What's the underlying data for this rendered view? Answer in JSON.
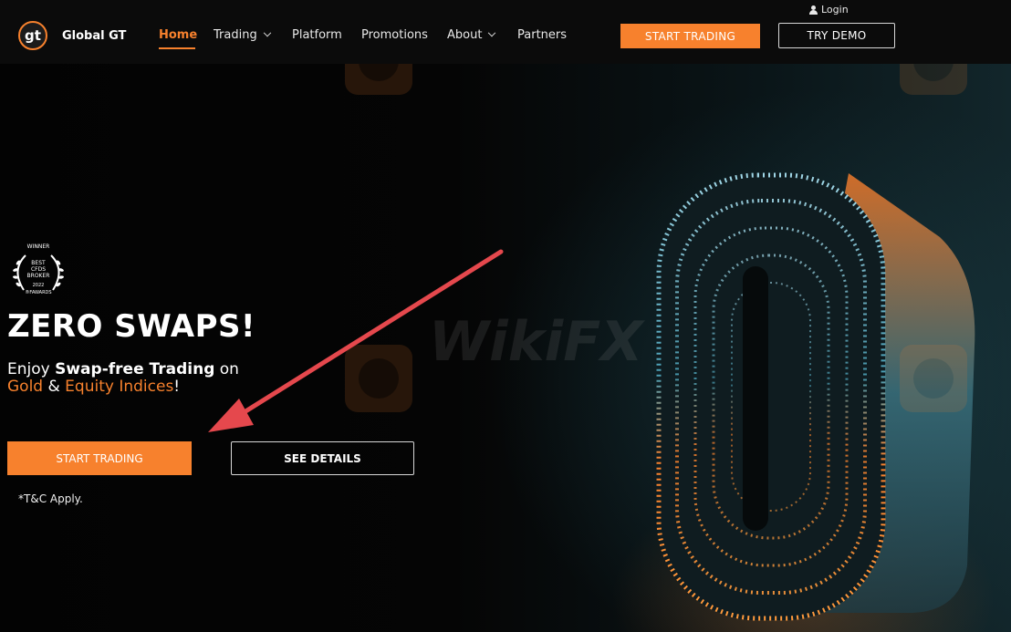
{
  "brand": {
    "logo_mark": "gt",
    "name": "Global GT",
    "accent_color": "#f7812d"
  },
  "nav": {
    "items": [
      {
        "label": "Home",
        "active": true,
        "dropdown": false
      },
      {
        "label": "Trading",
        "active": false,
        "dropdown": true
      },
      {
        "label": "Platform",
        "active": false,
        "dropdown": false
      },
      {
        "label": "Promotions",
        "active": false,
        "dropdown": false
      },
      {
        "label": "About",
        "active": false,
        "dropdown": true
      },
      {
        "label": "Partners",
        "active": false,
        "dropdown": false
      }
    ],
    "login_label": "Login",
    "start_trading_label": "START TRADING",
    "try_demo_label": "TRY DEMO"
  },
  "award": {
    "line1": "WINNER",
    "line2": "BEST",
    "line3": "CFDS",
    "line4": "BROKER",
    "line5": "2022",
    "line6": "®FAWARDS"
  },
  "hero": {
    "headline": "ZERO SWAPS!",
    "sub_prefix": "Enjoy ",
    "sub_bold": "Swap-free Trading",
    "sub_suffix": " on",
    "sub2_gold": "Gold",
    "sub2_amp": " & ",
    "sub2_indices": "Equity Indices",
    "sub2_end": "!",
    "start_trading_label": "START TRADING",
    "see_details_label": "SEE DETAILS",
    "disclaimer": "*T&C Apply."
  },
  "watermark": {
    "text": "WikiFX"
  },
  "icons": [
    "user-icon",
    "chevron-down-icon",
    "laurel-wreath-icon",
    "annotation-arrow-icon",
    "watermark-logo-icon"
  ]
}
